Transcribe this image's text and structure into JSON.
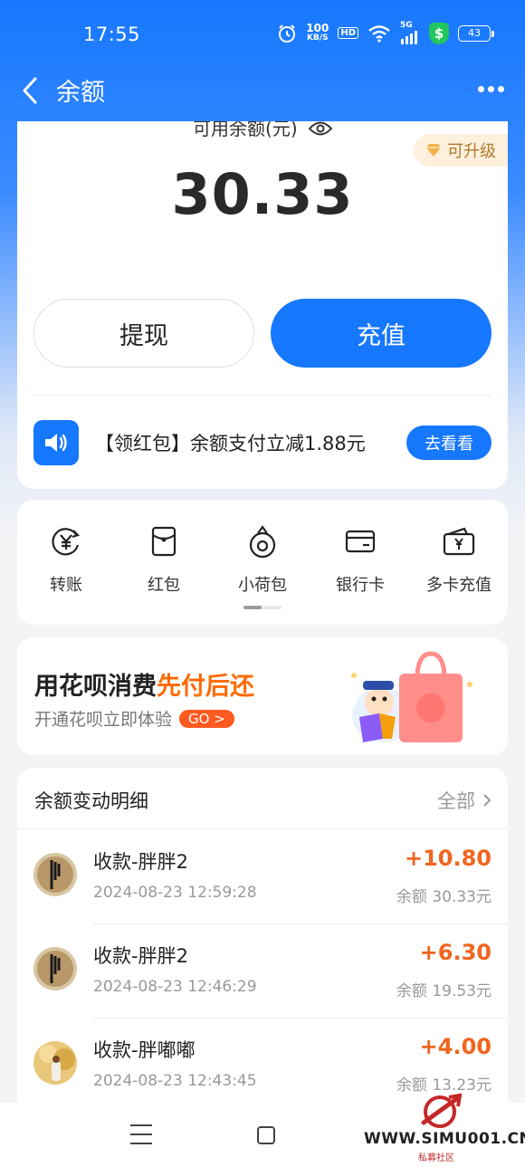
{
  "status_bar": {
    "time": "17:55",
    "net_speed_value": "100",
    "net_speed_unit": "KB/S",
    "hd_label": "HD",
    "signal_label": "5G",
    "battery": "43"
  },
  "header": {
    "title": "余额"
  },
  "balance": {
    "label": "可用余额(元)",
    "amount": "30.33",
    "upgrade_badge": "可升级",
    "withdraw_label": "提现",
    "recharge_label": "充值"
  },
  "promo": {
    "text": "【领红包】余额支付立减1.88元",
    "button": "去看看"
  },
  "shortcuts": [
    {
      "label": "转账",
      "icon": "yen-transfer-icon"
    },
    {
      "label": "红包",
      "icon": "red-packet-icon"
    },
    {
      "label": "小荷包",
      "icon": "purse-icon"
    },
    {
      "label": "银行卡",
      "icon": "bank-card-icon"
    },
    {
      "label": "多卡充值",
      "icon": "wallet-recharge-icon"
    }
  ],
  "ad": {
    "title_main": "用花呗消费",
    "title_highlight": "先付后还",
    "subtitle": "开通花呗立即体验",
    "go_label": "GO >"
  },
  "transactions": {
    "title": "余额变动明细",
    "filter_label": "全部",
    "items": [
      {
        "name": "收款-胖胖2",
        "time": "2024-08-23 12:59:28",
        "amount": "+10.80",
        "balance": "余额 30.33元"
      },
      {
        "name": "收款-胖胖2",
        "time": "2024-08-23 12:46:29",
        "amount": "+6.30",
        "balance": "余额 19.53元"
      },
      {
        "name": "收款-胖嘟嘟",
        "time": "2024-08-23 12:43:45",
        "amount": "+4.00",
        "balance": "余额 13.23元"
      }
    ]
  },
  "watermark": {
    "text": "WWW.SIMU001.CN",
    "sub": "私募社区"
  },
  "colors": {
    "brand_blue": "#1677ff",
    "amount_orange": "#f0651f",
    "highlight_orange": "#ff6a00"
  }
}
